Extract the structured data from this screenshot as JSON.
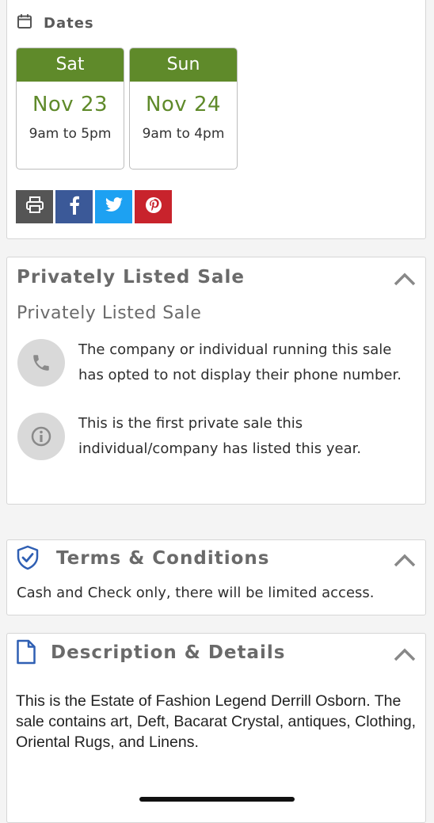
{
  "dates": {
    "header": "Dates",
    "days": [
      {
        "day": "Sat",
        "date": "Nov 23",
        "time": "9am to 5pm"
      },
      {
        "day": "Sun",
        "date": "Nov 24",
        "time": "9am to 4pm"
      }
    ]
  },
  "share": {
    "buttons": [
      {
        "name": "print",
        "color": "#555555"
      },
      {
        "name": "facebook",
        "color": "#3b5998"
      },
      {
        "name": "twitter",
        "color": "#1da1f2"
      },
      {
        "name": "pinterest",
        "color": "#c8232c"
      }
    ]
  },
  "private_sale": {
    "title": "Privately Listed Sale",
    "subtitle": "Privately Listed Sale",
    "phone_notice": "The company or individual running this sale has opted to not display their phone number.",
    "first_sale_notice": "This is the first private sale this individual/company has listed this year."
  },
  "terms": {
    "title": "Terms & Conditions",
    "text": "Cash and Check only, there will be limited access."
  },
  "description": {
    "title": "Description & Details",
    "text": "This is the Estate of Fashion Legend Derrill Osborn. The sale contains art, Deft, Bacarat  Crystal, antiques, Clothing, Oriental Rugs, and Linens."
  },
  "colors": {
    "accent_green": "#5f8a2a",
    "icon_blue": "#2f5fb3",
    "title_gray": "#6a6a6a"
  }
}
